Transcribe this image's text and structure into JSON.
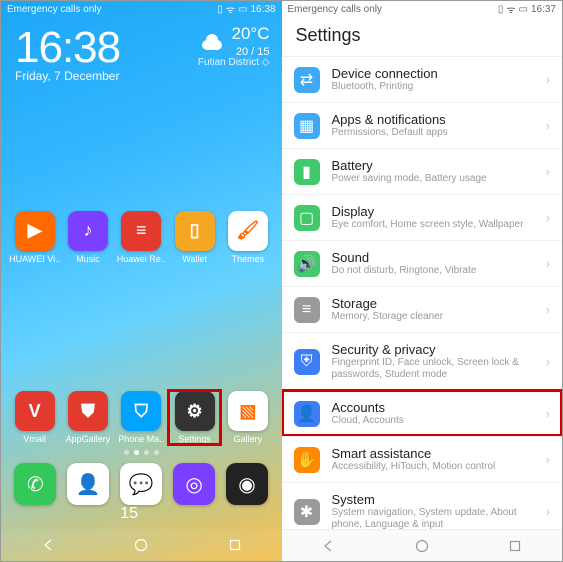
{
  "left": {
    "status_text": "Emergency calls only",
    "status_time": "16:38",
    "clock": "16:38",
    "date": "Friday, 7 December",
    "weather": {
      "temp": "20°C",
      "range": "20 / 15",
      "location": "Futian District"
    },
    "apps_row1": [
      {
        "label": "HUAWEI Vi..",
        "bg": "#ff6a00",
        "glyph": "▶"
      },
      {
        "label": "Music",
        "bg": "#7a3fff",
        "glyph": "♪"
      },
      {
        "label": "Huawei Re..",
        "bg": "#e23a2e",
        "glyph": "≡"
      },
      {
        "label": "Wallet",
        "bg": "#f5a623",
        "glyph": "▯"
      },
      {
        "label": "Themes",
        "bg": "#ffffff",
        "glyph": "🖌"
      }
    ],
    "apps_row2": [
      {
        "label": "Vmall",
        "bg": "#e23a2e",
        "glyph": "V"
      },
      {
        "label": "AppGallery",
        "bg": "#e23a2e",
        "glyph": "⛊"
      },
      {
        "label": "Phone Ma..",
        "bg": "#00a3ff",
        "glyph": "⛉"
      },
      {
        "label": "Settings",
        "bg": "#333333",
        "glyph": "⚙",
        "highlight": true
      },
      {
        "label": "Gallery",
        "bg": "#ffffff",
        "glyph": "▧"
      }
    ],
    "dock": [
      {
        "name": "phone",
        "bg": "#34c759",
        "glyph": "✆"
      },
      {
        "name": "contacts",
        "bg": "#ffffff",
        "glyph": "👤"
      },
      {
        "name": "messages",
        "bg": "#ffffff",
        "glyph": "💬",
        "badge": "15"
      },
      {
        "name": "browser",
        "bg": "#7a3fff",
        "glyph": "◎"
      },
      {
        "name": "camera",
        "bg": "#222222",
        "glyph": "◉"
      }
    ]
  },
  "right": {
    "status_text": "Emergency calls only",
    "status_time": "16:37",
    "title": "Settings",
    "items": [
      {
        "title": "Device connection",
        "sub": "Bluetooth, Printing",
        "color": "#3fa9f5",
        "glyph": "⇄"
      },
      {
        "title": "Apps & notifications",
        "sub": "Permissions, Default apps",
        "color": "#3fa9f5",
        "glyph": "▦"
      },
      {
        "title": "Battery",
        "sub": "Power saving mode, Battery usage",
        "color": "#41c96b",
        "glyph": "▮"
      },
      {
        "title": "Display",
        "sub": "Eye comfort, Home screen style, Wallpaper",
        "color": "#41c96b",
        "glyph": "▢"
      },
      {
        "title": "Sound",
        "sub": "Do not disturb, Ringtone, Vibrate",
        "color": "#41c96b",
        "glyph": "🔊"
      },
      {
        "title": "Storage",
        "sub": "Memory, Storage cleaner",
        "color": "#9a9a9a",
        "glyph": "≡"
      },
      {
        "title": "Security & privacy",
        "sub": "Fingerprint ID, Face unlock, Screen lock & passwords, Student mode",
        "color": "#3f7df5",
        "glyph": "⛨"
      },
      {
        "title": "Accounts",
        "sub": "Cloud, Accounts",
        "color": "#3f7df5",
        "glyph": "👤",
        "highlight": true
      },
      {
        "title": "Smart assistance",
        "sub": "Accessibility, HiTouch, Motion control",
        "color": "#ff8a00",
        "glyph": "✋"
      },
      {
        "title": "System",
        "sub": "System navigation, System update, About phone, Language & input",
        "color": "#9a9a9a",
        "glyph": "✱"
      }
    ]
  }
}
